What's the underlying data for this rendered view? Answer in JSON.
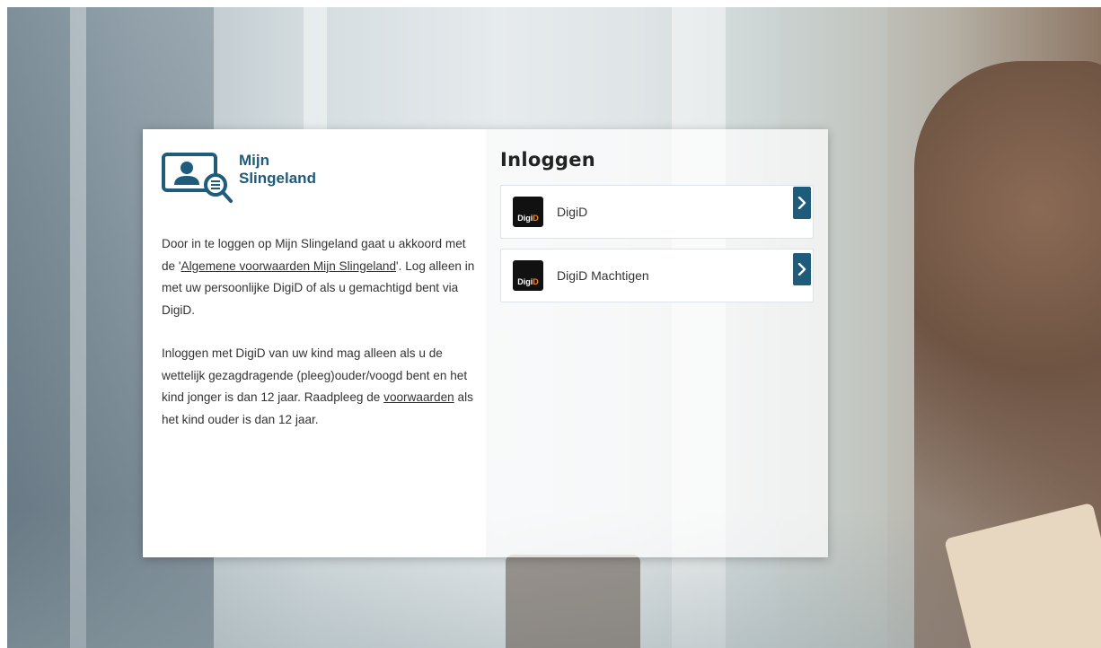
{
  "logo": {
    "line1": "Mijn",
    "line2": "Slingeland"
  },
  "intro": {
    "p1_before": "Door in te loggen op Mijn Slingeland gaat u akkoord met de '",
    "p1_link": "Algemene voorwaarden Mijn Slingeland",
    "p1_after": "'. Log alleen in met uw persoonlijke DigiD of als u gemachtigd bent via DigiD.",
    "p2_before": "Inloggen met DigiD van uw kind mag alleen als u de wettelijk gezagdragende (pleeg)ouder/voogd bent en het kind jonger is dan 12 jaar. Raadpleeg de ",
    "p2_link": "voorwaarden",
    "p2_after": " als het kind ouder is dan 12 jaar."
  },
  "login": {
    "title": "Inloggen",
    "options": [
      {
        "label": "DigiD",
        "badge_white": "Digi",
        "badge_orange": "D"
      },
      {
        "label": "DigiD Machtigen",
        "badge_white": "Digi",
        "badge_orange": "D"
      }
    ]
  },
  "colors": {
    "brand": "#1f5b7a",
    "digid_orange": "#f08a24",
    "badge_bg": "#111111"
  },
  "icons": {
    "logo": "user-screen-magnifier-icon",
    "chevron": "chevron-right-icon"
  }
}
